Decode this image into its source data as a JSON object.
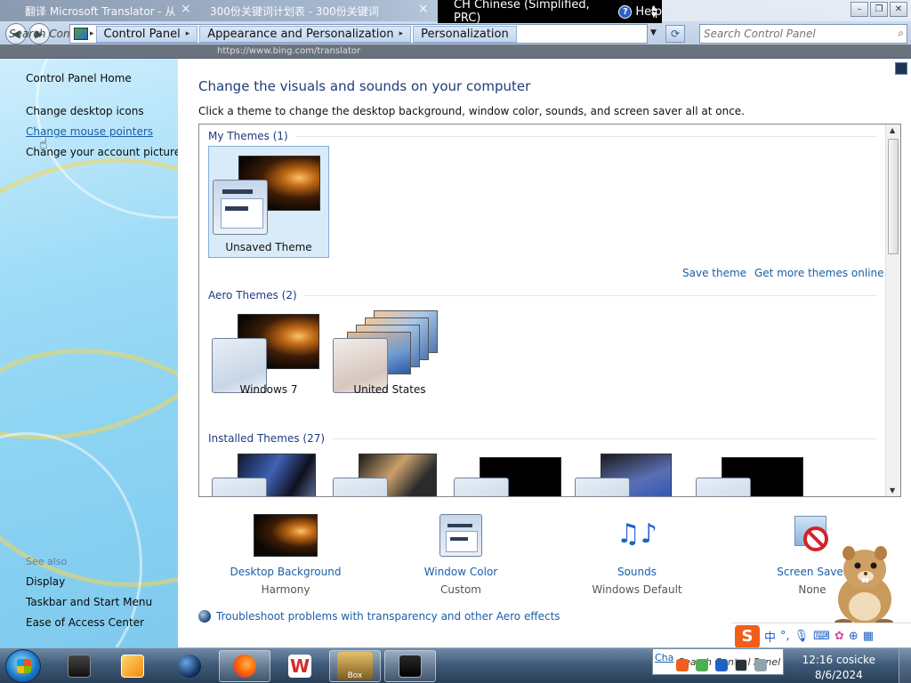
{
  "ghost": {
    "tab1_title": "翻译 Microsoft Translator - 从",
    "tab2_title": "300份关键词计划表 - 300份关键词",
    "url": "https://www.bing.com/translator"
  },
  "language_bar": {
    "language": "CH Chinese (Simplified, PRC)",
    "help_label": "Help"
  },
  "address_bar": {
    "ghost_search_text": "Search Con",
    "breadcrumbs": [
      {
        "label": "Control Panel"
      },
      {
        "label": "Appearance and Personalization"
      },
      {
        "label": "Personalization"
      }
    ],
    "search_placeholder": "Search Control Panel"
  },
  "left_pane": {
    "home_link": "Control Panel Home",
    "links": [
      {
        "label": "Change desktop icons"
      },
      {
        "label": "Change mouse pointers"
      },
      {
        "label": "Change your account picture"
      }
    ],
    "see_also_title": "See also",
    "see_also": [
      {
        "label": "Display"
      },
      {
        "label": "Taskbar and Start Menu"
      },
      {
        "label": "Ease of Access Center"
      }
    ]
  },
  "main": {
    "title": "Change the visuals and sounds on your computer",
    "description": "Click a theme to change the desktop background, window color, sounds, and screen saver all at once.",
    "groups": {
      "my_themes": "My Themes (1)",
      "aero_themes": "Aero Themes (2)",
      "installed_themes": "Installed Themes (27)"
    },
    "themes": {
      "unsaved": "Unsaved Theme",
      "windows7": "Windows 7",
      "united_states": "United States"
    },
    "save_theme_link": "Save theme",
    "get_more_link": "Get more themes online",
    "settings": [
      {
        "label": "Desktop Background",
        "value": "Harmony"
      },
      {
        "label": "Window Color",
        "value": "Custom"
      },
      {
        "label": "Sounds",
        "value": "Windows Default"
      },
      {
        "label": "Screen Saver",
        "value": "None"
      }
    ],
    "troubleshoot_link": "Troubleshoot problems with transparency and other Aero effects"
  },
  "ime": {
    "logo": "S",
    "mode": "中",
    "punct": "°,"
  },
  "taskbar": {
    "preview_tag": "Cha",
    "preview_search": "Search Control Panel",
    "time": "12:16 cosicke",
    "date": "8/6/2024",
    "game_label": "Box"
  },
  "colors": {
    "link": "#1a5ea8",
    "heading": "#1e3c7b"
  }
}
